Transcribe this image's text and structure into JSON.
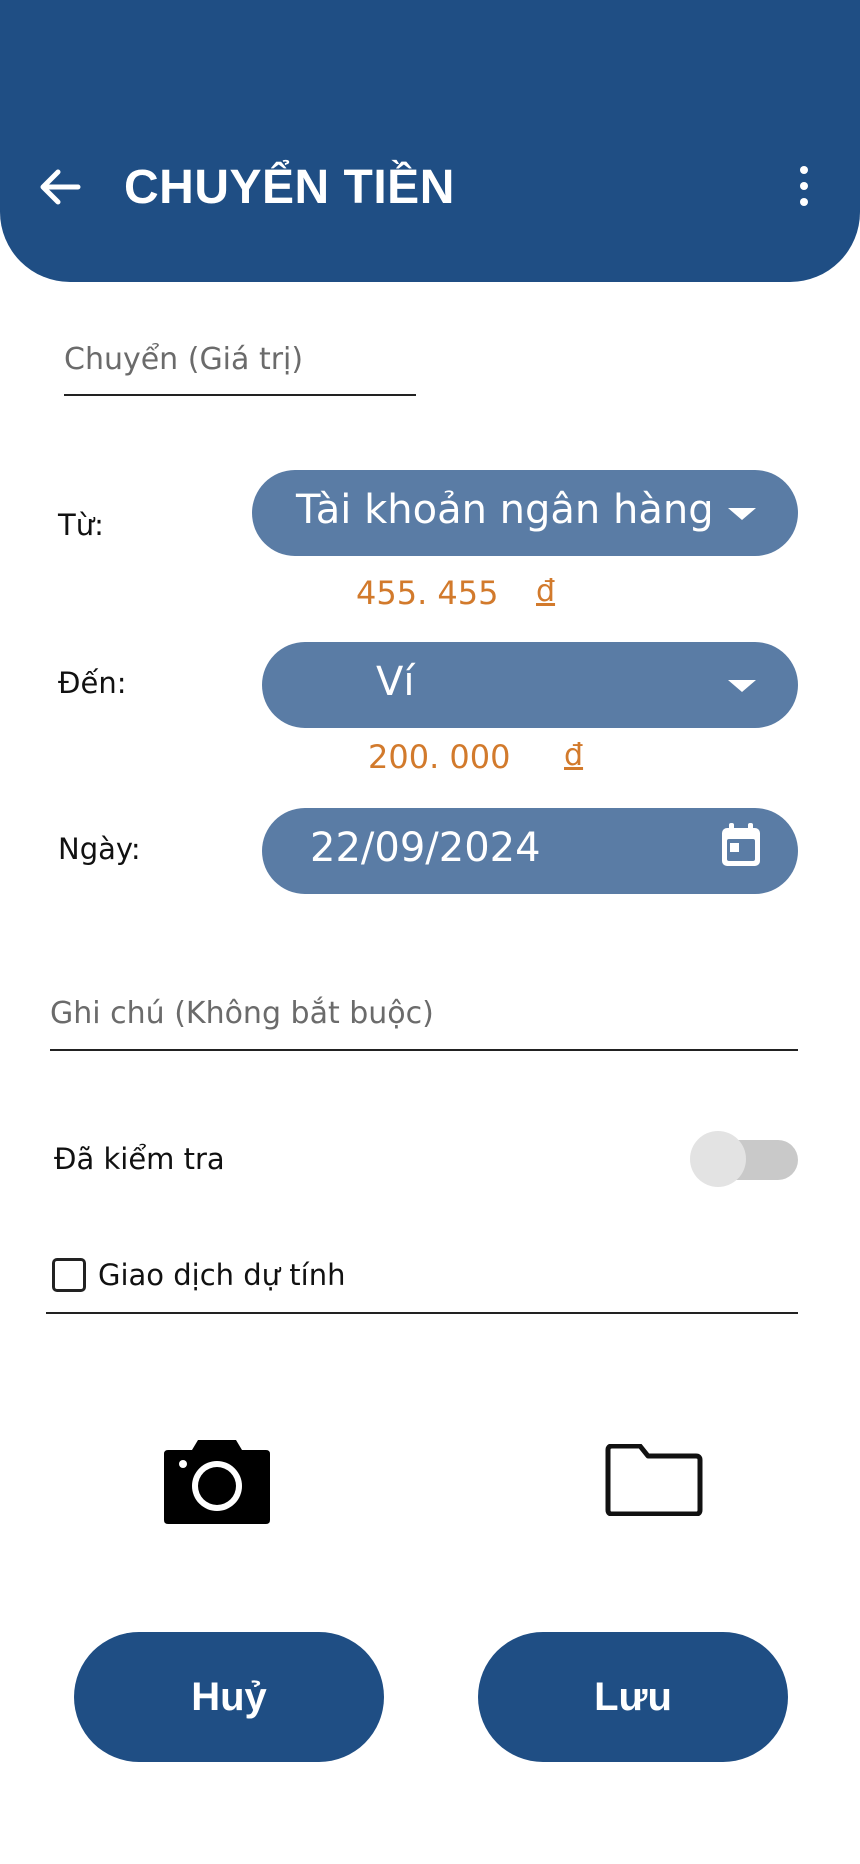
{
  "header": {
    "title": "CHUYỂN TIỀN",
    "back_icon": "arrow-left-icon",
    "menu_icon": "more-vertical-icon",
    "color": "#1f4e84"
  },
  "form": {
    "amount_placeholder": "Chuyển (Giá trị)",
    "from": {
      "label": "Từ:",
      "selected": "Tài khoản ngân hàng",
      "balance": "455. 455",
      "currency": "đ"
    },
    "to": {
      "label": "Đến:",
      "selected": "Ví",
      "balance": "200. 000",
      "currency": "đ"
    },
    "date": {
      "label": "Ngày:",
      "value": "22/09/2024",
      "icon": "calendar-icon"
    },
    "note_placeholder": "Ghi chú (Không bắt buộc)",
    "checked": {
      "label": "Đã kiểm tra",
      "value": false
    },
    "scheduled": {
      "label": "Giao dịch dự tính",
      "value": false
    }
  },
  "attachments": {
    "camera_icon": "camera-icon",
    "folder_icon": "folder-icon"
  },
  "actions": {
    "cancel_label": "Huỷ",
    "save_label": "Lưu"
  },
  "colors": {
    "pill": "#5a7ca5",
    "amount": "#d27a2c"
  }
}
